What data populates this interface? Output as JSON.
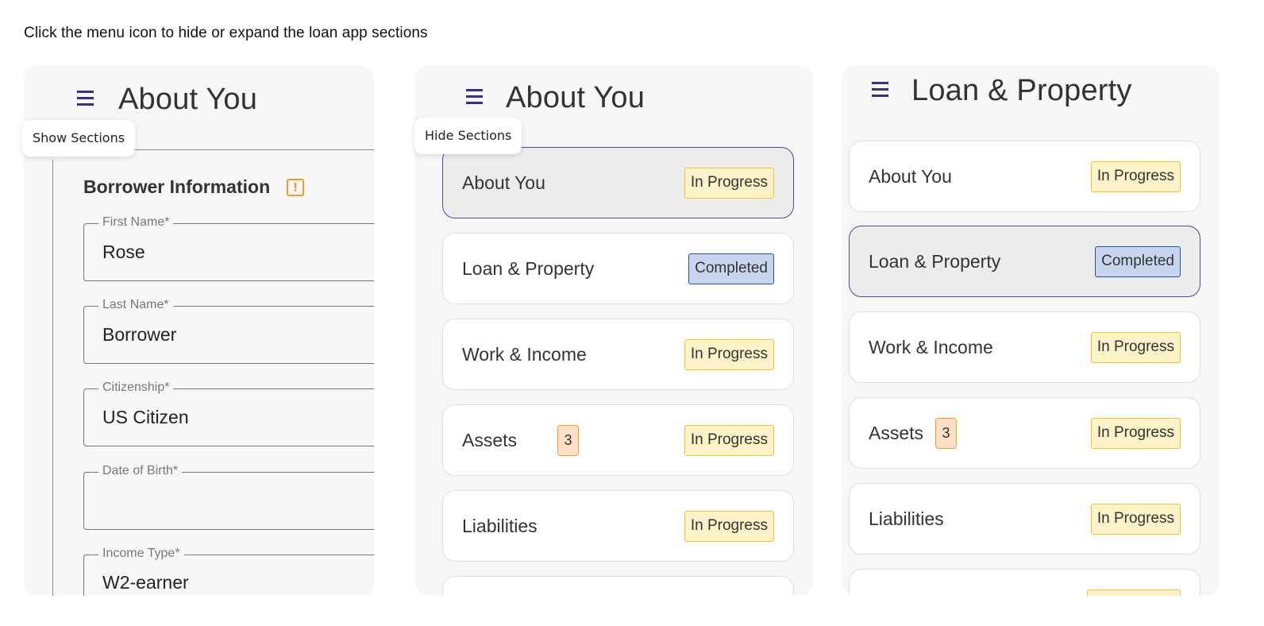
{
  "instruction": "Click the menu icon to hide or expand the loan app sections",
  "colors": {
    "accent": "#4b4a9c",
    "in_progress": "#f1c232",
    "completed": "#2a4fa4",
    "warning": "#f39b2c"
  },
  "panel1": {
    "title": "About You",
    "tooltip": "Show Sections",
    "section_title": "Borrower Information",
    "warning_icon": "!",
    "fields": [
      {
        "label": "First Name*",
        "value": "Rose"
      },
      {
        "label": "Last Name*",
        "value": "Borrower"
      },
      {
        "label": "Citizenship*",
        "value": "US Citizen"
      },
      {
        "label": "Date of Birth*",
        "value": ""
      },
      {
        "label": "Income Type*",
        "value": "W2-earner"
      }
    ]
  },
  "panel2": {
    "title": "About You",
    "tooltip": "Hide Sections",
    "sections": [
      {
        "label": "About You",
        "status": "In Progress"
      },
      {
        "label": "Loan & Property",
        "status": "Completed"
      },
      {
        "label": "Work & Income",
        "status": "In Progress"
      },
      {
        "label": "Assets",
        "count": "3",
        "status": "In Progress"
      },
      {
        "label": "Liabilities",
        "status": "In Progress"
      }
    ]
  },
  "panel3": {
    "title": "Loan & Property",
    "sections": [
      {
        "label": "About You",
        "status": "In Progress"
      },
      {
        "label": "Loan & Property",
        "status": "Completed"
      },
      {
        "label": "Work & Income",
        "status": "In Progress"
      },
      {
        "label": "Assets",
        "count": "3",
        "status": "In Progress"
      },
      {
        "label": "Liabilities",
        "status": "In Progress"
      }
    ]
  }
}
